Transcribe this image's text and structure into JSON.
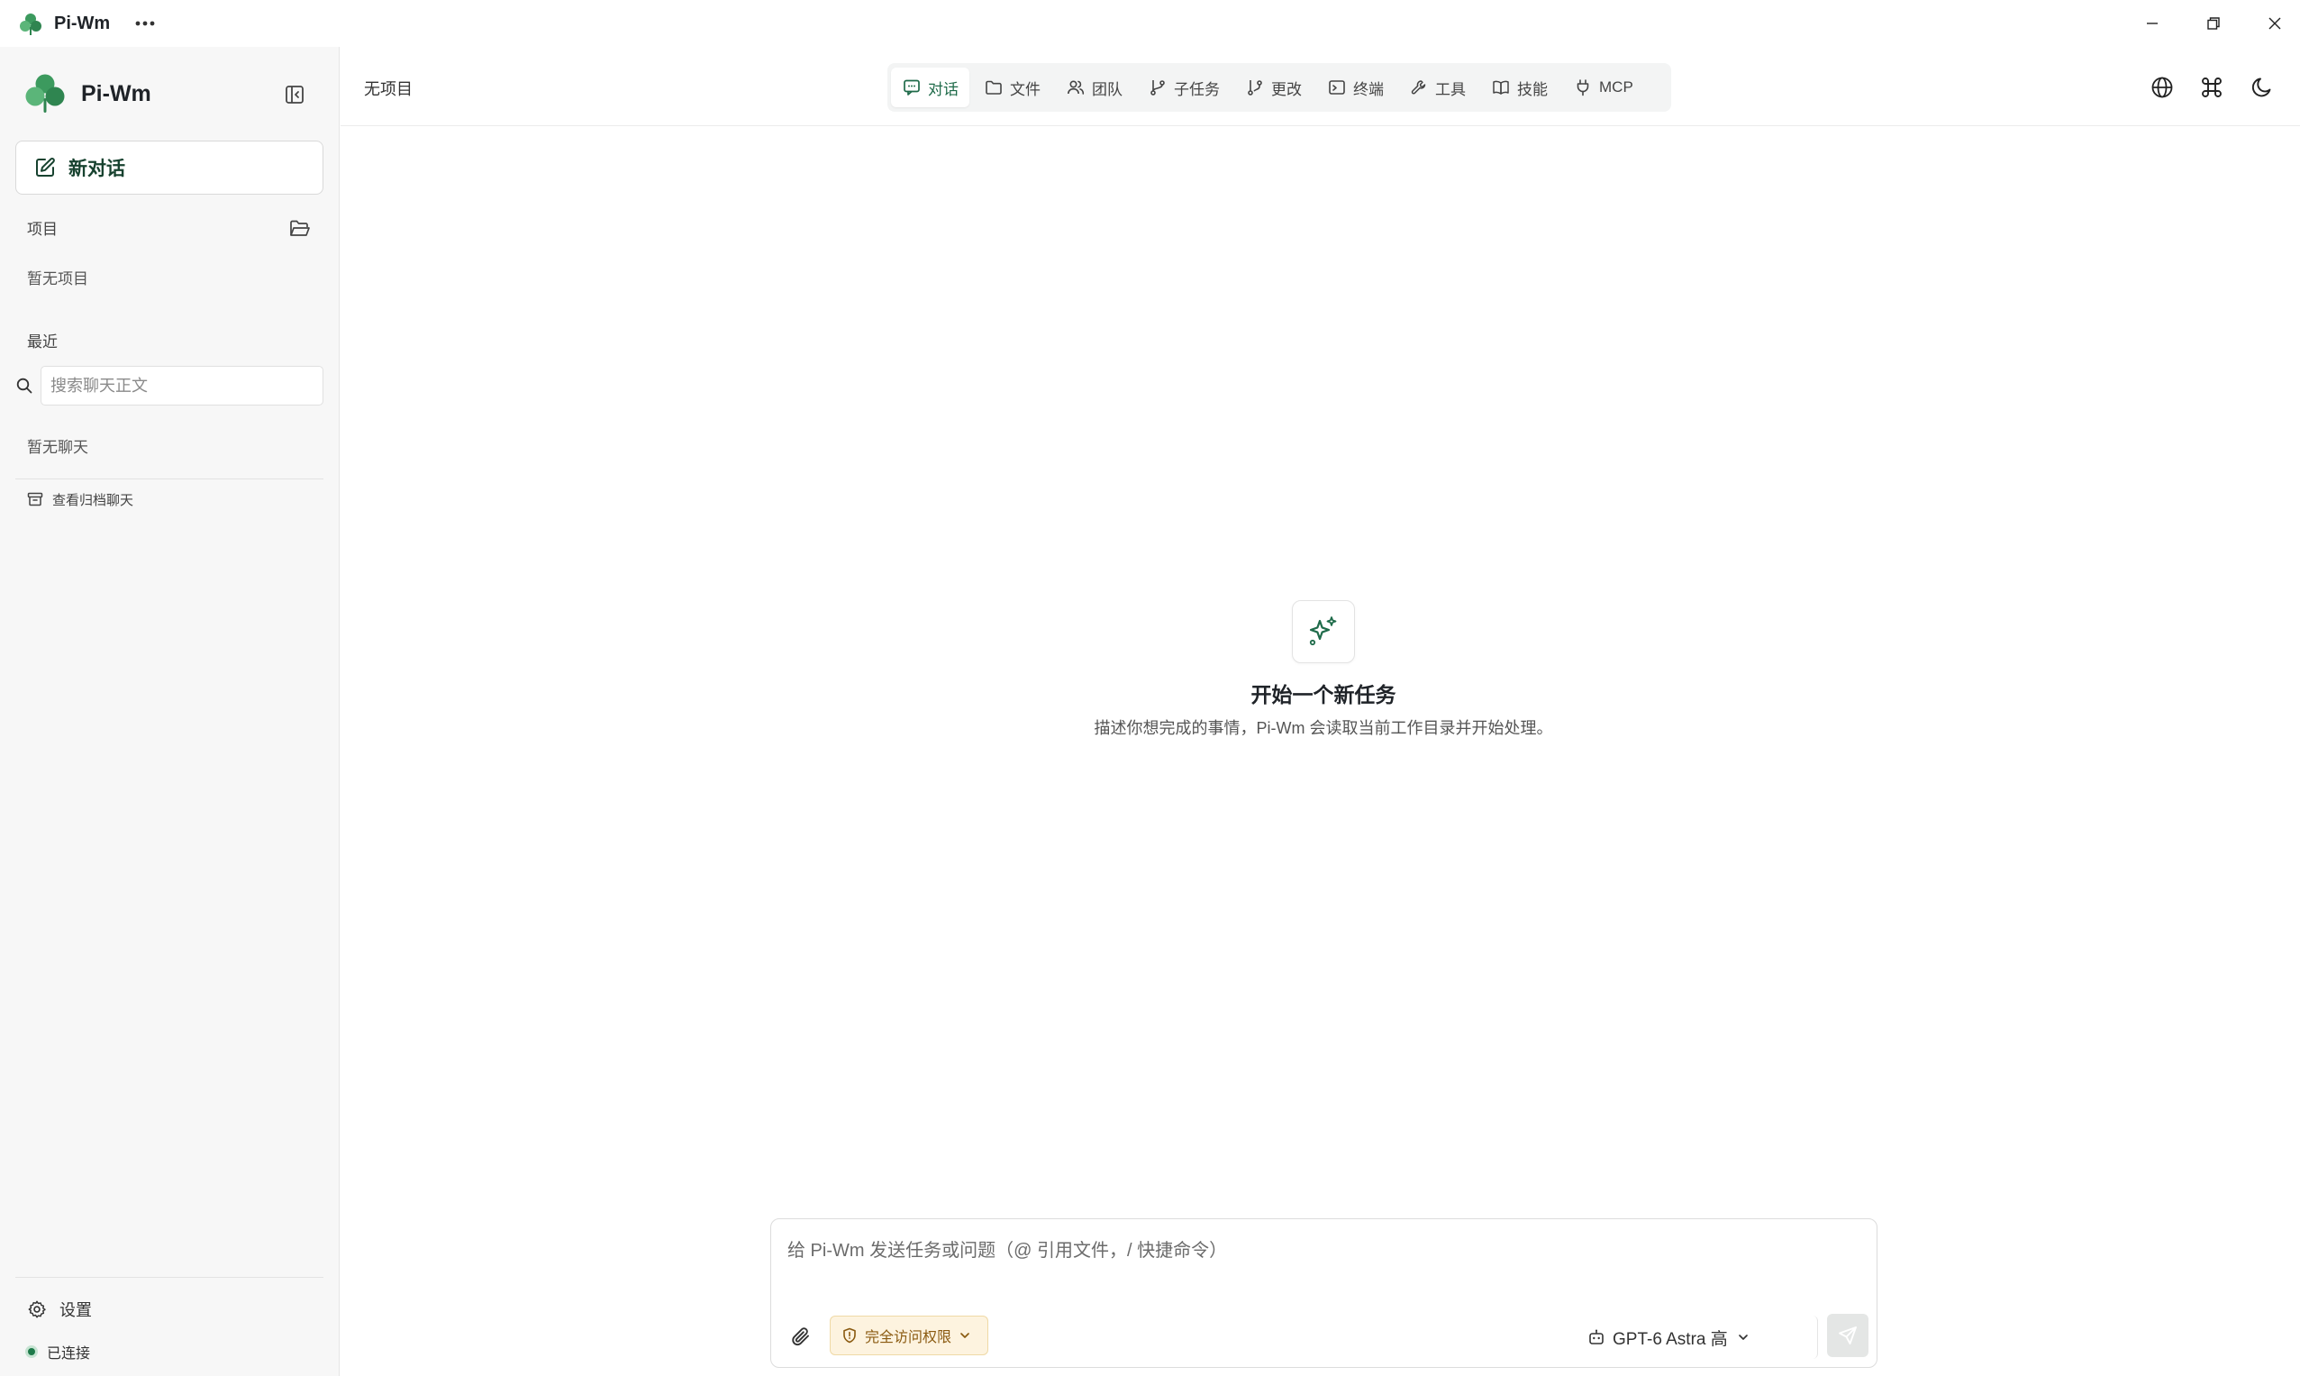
{
  "app": {
    "title": "Pi-Wm",
    "more_icon": "more-horizontal-icon"
  },
  "window_controls": {
    "minimize_icon": "minimize-icon",
    "maximize_icon": "restore-icon",
    "close_icon": "close-icon"
  },
  "sidebar": {
    "brand": "Pi-Wm",
    "new_chat_label": "新对话",
    "projects_label": "项目",
    "projects_empty": "暂无项目",
    "recent_label": "最近",
    "search_placeholder": "搜索聊天正文",
    "chats_empty": "暂无聊天",
    "archive_label": "查看归档聊天",
    "settings_label": "设置",
    "status_label": "已连接"
  },
  "header": {
    "project_crumb": "无项目",
    "tabs": [
      {
        "label": "对话",
        "icon": "chat-icon",
        "active": true
      },
      {
        "label": "文件",
        "icon": "folder-icon",
        "active": false
      },
      {
        "label": "团队",
        "icon": "users-icon",
        "active": false
      },
      {
        "label": "子任务",
        "icon": "git-branch-icon",
        "active": false
      },
      {
        "label": "更改",
        "icon": "git-compare-icon",
        "active": false
      },
      {
        "label": "终端",
        "icon": "terminal-icon",
        "active": false
      },
      {
        "label": "工具",
        "icon": "wrench-icon",
        "active": false
      },
      {
        "label": "技能",
        "icon": "book-icon",
        "active": false
      },
      {
        "label": "MCP",
        "icon": "plug-icon",
        "active": false
      }
    ],
    "right_icons": [
      "globe-icon",
      "command-icon",
      "moon-icon"
    ]
  },
  "empty_state": {
    "icon": "sparkles-icon",
    "title": "开始一个新任务",
    "description": "描述你想完成的事情，Pi-Wm 会读取当前工作目录并开始处理。"
  },
  "composer": {
    "placeholder": "给 Pi-Wm 发送任务或问题（@ 引用文件，/ 快捷命令）",
    "permission_label": "完全访问权限",
    "model_label": "GPT-6 Astra 高"
  },
  "colors": {
    "accent": "#1f6b4a",
    "brand_green": "#3a9a5b",
    "permission_bg": "#fdf3df",
    "permission_text": "#8a5a10"
  }
}
